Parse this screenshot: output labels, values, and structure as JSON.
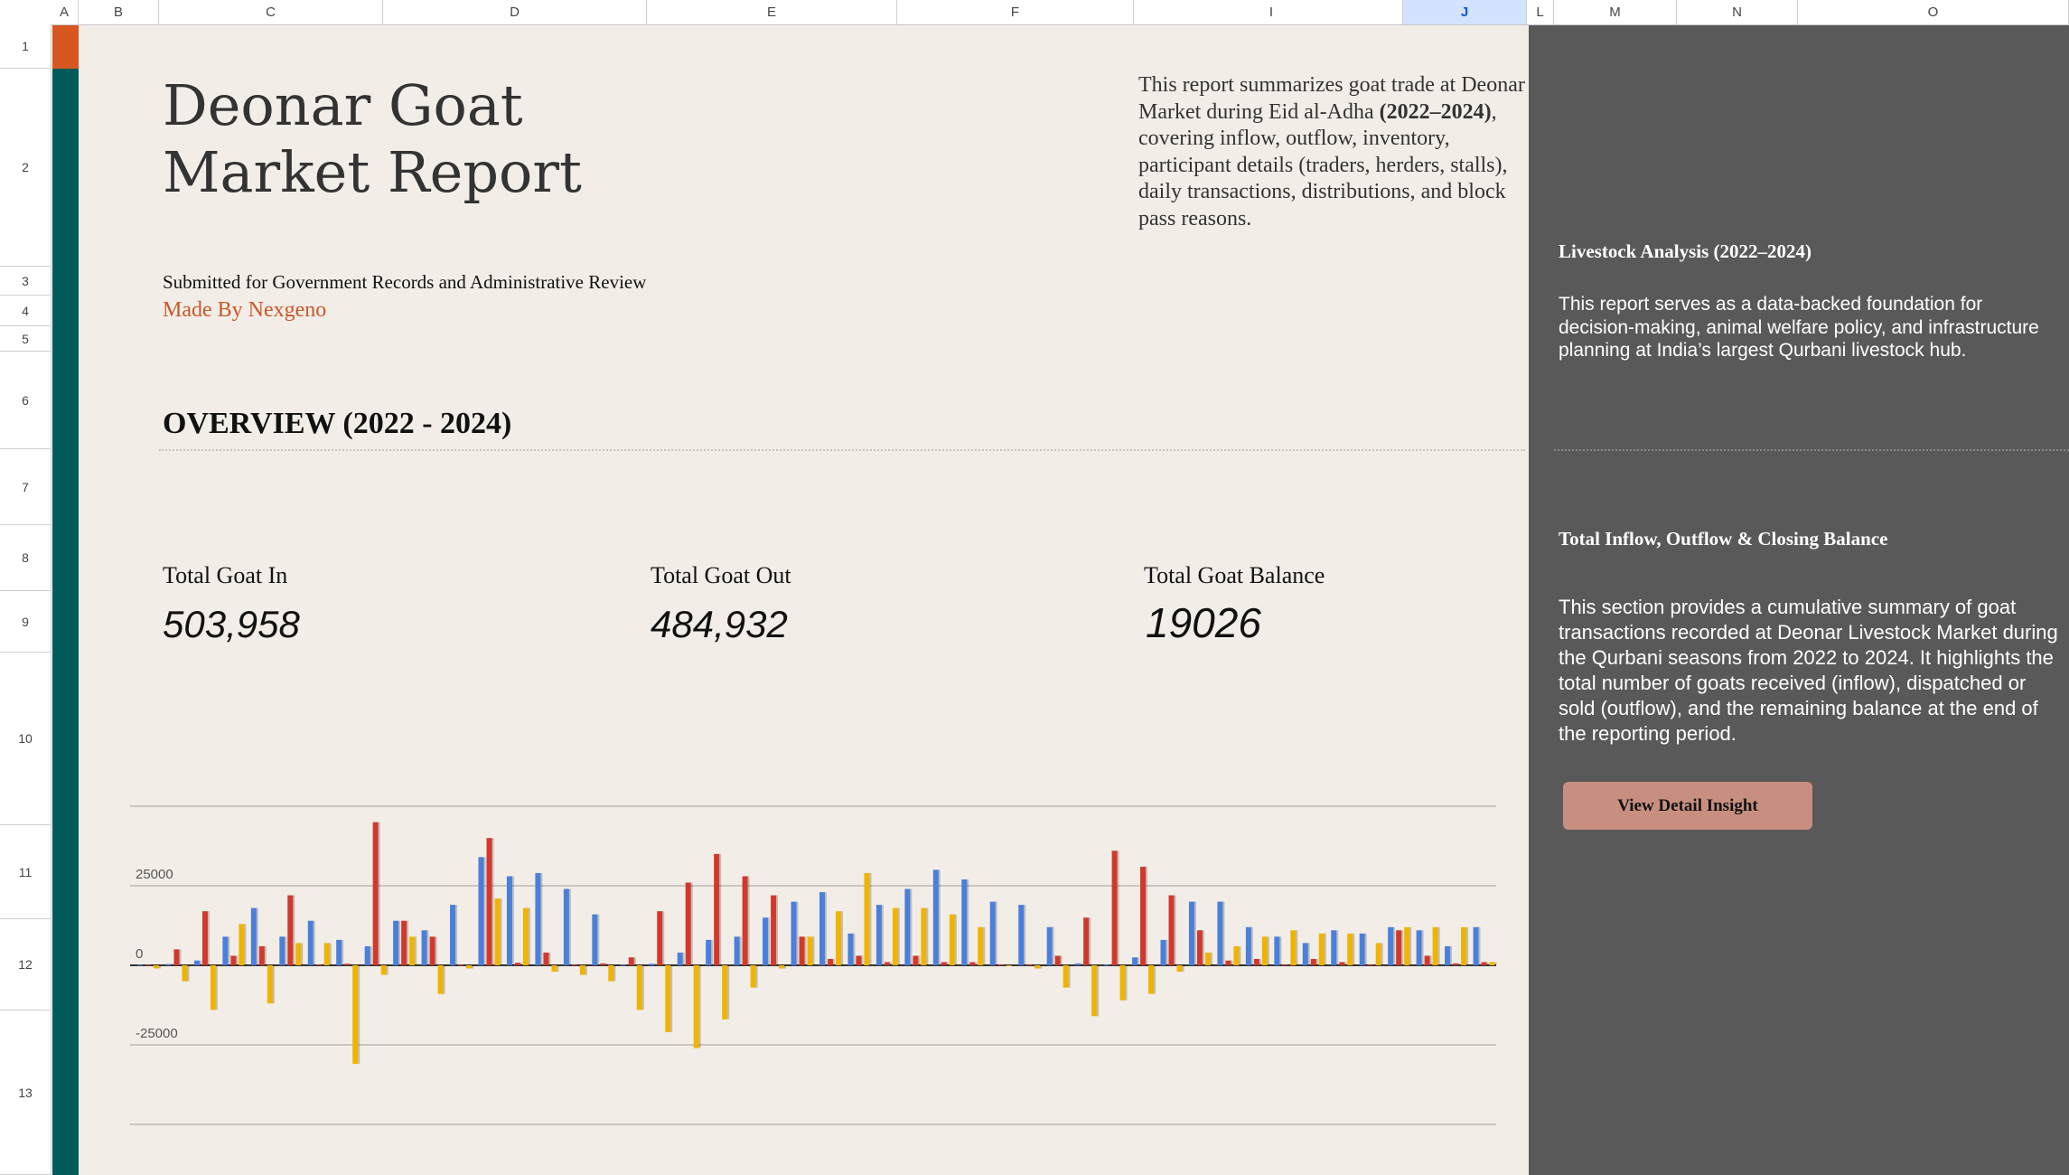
{
  "sheet": {
    "columns": [
      "A",
      "B",
      "C",
      "D",
      "E",
      "F",
      "I",
      "J",
      "L",
      "M",
      "N",
      "O"
    ],
    "selected_column": "J",
    "rows": [
      "1",
      "2",
      "3",
      "4",
      "5",
      "6",
      "7",
      "8",
      "9",
      "10",
      "11",
      "12",
      "13"
    ]
  },
  "report": {
    "title": "Deonar Goat Market Report",
    "intro_before": "This report summarizes goat trade at Deonar Market during Eid al-Adha ",
    "intro_bold": "(2022–2024)",
    "intro_after": ", covering inflow, outflow, inventory, participant details (traders, herders, stalls), daily transactions, distributions, and block pass reasons.",
    "submitted": "Submitted for Government Records and Administrative Review",
    "made_by": "Made By Nexgeno",
    "overview_heading": "OVERVIEW (2022 - 2024)"
  },
  "stats": [
    {
      "label": "Total Goat In",
      "value": "503,958"
    },
    {
      "label": "Total Goat Out",
      "value": "484,932"
    },
    {
      "label": "Total Goat Balance",
      "value": "19026"
    }
  ],
  "side": {
    "heading1": "Livestock Analysis (2022–2024)",
    "para1": "This report serves as a data-backed foundation for decision-making, animal welfare policy, and infrastructure planning at India’s largest Qurbani livestock hub.",
    "heading2": "Total Inflow, Outflow & Closing Balance",
    "para2": "This section provides a cumulative summary of goat transactions recorded at Deonar Livestock Market during the Qurbani seasons from 2022 to 2024. It highlights the total number of goats received (inflow), dispatched or sold (outflow), and the remaining balance at the end of the reporting period.",
    "button": "View Detail Insight"
  },
  "colors": {
    "inflow": "#4a7fdc",
    "outflow": "#d2382c",
    "balance": "#f0b400",
    "accent": "#d8561f",
    "teal": "#005b5b"
  },
  "chart_data": {
    "type": "bar",
    "y_ticks": [
      "25000",
      "0",
      "-25000"
    ],
    "ylim": [
      -50000,
      50000
    ],
    "series": [
      {
        "values": [
          200,
          400,
          1500,
          9000,
          18000,
          9000,
          14000,
          8000,
          6000,
          14000,
          11000,
          19000,
          34000,
          28000,
          29000,
          24000,
          16000,
          200,
          500,
          4000,
          8000,
          9000,
          15000,
          20000,
          23000,
          10000,
          19000,
          24000,
          30000,
          27000,
          20000,
          19000,
          12000,
          600,
          200,
          2500,
          8000,
          20000,
          20000,
          12000,
          9000,
          7000,
          11000,
          10000,
          12000,
          11000,
          6000,
          12000
        ]
      },
      {
        "values": [
          200,
          5000,
          17000,
          3000,
          6000,
          22000,
          300,
          500,
          45000,
          14000,
          9000,
          200,
          40000,
          800,
          4000,
          200,
          600,
          2500,
          17000,
          26000,
          35000,
          28000,
          22000,
          9000,
          2000,
          3000,
          1000,
          3000,
          1000,
          1000,
          300,
          300,
          3000,
          15000,
          36000,
          31000,
          22000,
          11000,
          1500,
          2000,
          300,
          2000,
          1000,
          300,
          11000,
          3000,
          600,
          1000
        ]
      },
      {
        "values": [
          -1000,
          -5000,
          -14000,
          13000,
          -12000,
          7000,
          7000,
          -31000,
          -3000,
          9000,
          -9000,
          -1000,
          21000,
          18000,
          -2000,
          -3000,
          -5000,
          -14000,
          -21000,
          -26000,
          -17000,
          -7000,
          -1000,
          9000,
          17000,
          29000,
          18000,
          18000,
          16000,
          12000,
          -200,
          -1000,
          -7000,
          -16000,
          -11000,
          -9000,
          -2000,
          4000,
          6000,
          9000,
          11000,
          10000,
          10000,
          7000,
          12000,
          12000,
          12000,
          1000
        ]
      }
    ]
  }
}
